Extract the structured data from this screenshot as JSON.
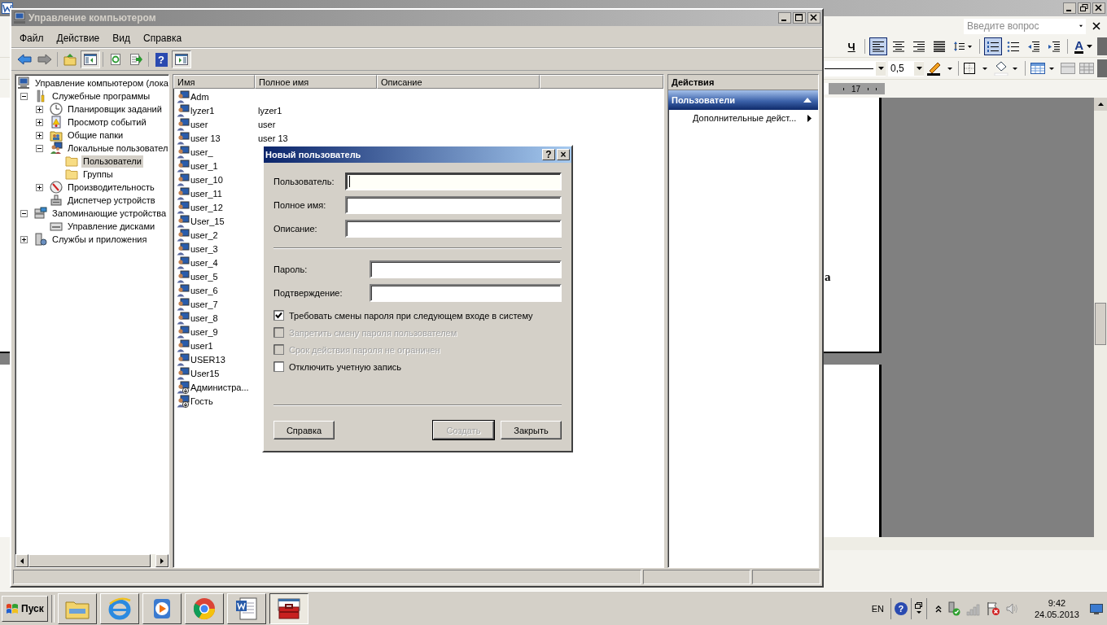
{
  "word_window": {
    "help_search": {
      "placeholder": "Введите вопрос"
    },
    "format_toolbar": [
      {
        "kind": "underline",
        "label": "Ч",
        "selected": false
      },
      {
        "kind": "align-left",
        "selected": true
      },
      {
        "kind": "align-center",
        "selected": false
      },
      {
        "kind": "align-right",
        "selected": false
      },
      {
        "kind": "justify",
        "selected": false
      },
      {
        "kind": "line-spacing",
        "selected": false
      },
      {
        "kind": "numbering",
        "selected": true
      },
      {
        "kind": "bullets",
        "selected": false
      },
      {
        "kind": "outdent",
        "selected": false
      },
      {
        "kind": "indent",
        "selected": false
      },
      {
        "kind": "font-color",
        "label": "A",
        "selected": false
      }
    ],
    "line_weight": "0,5",
    "ruler_mark": "17",
    "page_text": "а"
  },
  "window": {
    "title": "Управление компьютером"
  },
  "menu": [
    "Файл",
    "Действие",
    "Вид",
    "Справка"
  ],
  "toolbar": [
    {
      "kind": "back",
      "selected": false
    },
    {
      "kind": "forward",
      "selected": false
    },
    {
      "kind": "up",
      "selected": false
    },
    {
      "kind": "tree-toggle",
      "selected": true
    },
    {
      "kind": "refresh",
      "selected": false
    },
    {
      "kind": "export",
      "selected": false
    },
    {
      "kind": "help",
      "label": "?",
      "selected": false
    },
    {
      "kind": "actions-toggle",
      "selected": true
    }
  ],
  "tree": [
    {
      "label": "Управление компьютером (лока",
      "kind": "computer",
      "selected": false,
      "children": [
        {
          "label": "Служебные программы",
          "kind": "tools",
          "expanded": true,
          "selected": false,
          "children": [
            {
              "label": "Планировщик заданий",
              "kind": "clock",
              "expanded": false,
              "selected": false
            },
            {
              "label": "Просмотр событий",
              "kind": "log",
              "expanded": false,
              "selected": false
            },
            {
              "label": "Общие папки",
              "kind": "share",
              "expanded": false,
              "selected": false
            },
            {
              "label": "Локальные пользовател",
              "kind": "users",
              "expanded": true,
              "selected": false,
              "children": [
                {
                  "label": "Пользователи",
                  "kind": "folder",
                  "selected": true
                },
                {
                  "label": "Группы",
                  "kind": "folder",
                  "selected": false
                }
              ]
            },
            {
              "label": "Производительность",
              "kind": "gauge",
              "expanded": false,
              "selected": false
            },
            {
              "label": "Диспетчер устройств",
              "kind": "device",
              "selected": false
            }
          ]
        },
        {
          "label": "Запоминающие устройства",
          "kind": "storage",
          "expanded": true,
          "selected": false,
          "children": [
            {
              "label": "Управление дисками",
              "kind": "disk",
              "selected": false
            }
          ]
        },
        {
          "label": "Службы и приложения",
          "kind": "services",
          "expanded": false,
          "selected": false
        }
      ]
    }
  ],
  "list": {
    "columns": [
      "Имя",
      "Полное имя",
      "Описание"
    ],
    "rows": [
      {
        "name": "Adm",
        "disabled": false
      },
      {
        "name": "lyzer1",
        "full_name": "lyzer1",
        "disabled": false
      },
      {
        "name": "user",
        "full_name": "user",
        "disabled": false
      },
      {
        "name": "user 13",
        "full_name": "user 13",
        "disabled": false
      },
      {
        "name": "user_",
        "disabled": false
      },
      {
        "name": "user_1",
        "disabled": false
      },
      {
        "name": "user_10",
        "disabled": false
      },
      {
        "name": "user_11",
        "disabled": false
      },
      {
        "name": "user_12",
        "disabled": false
      },
      {
        "name": "User_15",
        "disabled": false
      },
      {
        "name": "user_2",
        "disabled": false
      },
      {
        "name": "user_3",
        "disabled": false
      },
      {
        "name": "user_4",
        "disabled": false
      },
      {
        "name": "user_5",
        "disabled": false
      },
      {
        "name": "user_6",
        "disabled": false
      },
      {
        "name": "user_7",
        "disabled": false
      },
      {
        "name": "user_8",
        "disabled": false
      },
      {
        "name": "user_9",
        "disabled": false
      },
      {
        "name": "user1",
        "disabled": false
      },
      {
        "name": "USER13",
        "disabled": false
      },
      {
        "name": "User15",
        "disabled": false
      },
      {
        "name": "Администра...",
        "disabled": true
      },
      {
        "name": "Гость",
        "disabled": true
      }
    ]
  },
  "actions": {
    "title": "Действия",
    "section": {
      "title": "Пользователи",
      "expanded": true
    },
    "items": [
      "Дополнительные дейст..."
    ]
  },
  "dialog": {
    "title": "Новый пользователь",
    "help": "?",
    "close": "×",
    "fields": [
      {
        "label": "Пользователь:",
        "focused": true
      },
      {
        "label": "Полное имя:",
        "focused": false
      },
      {
        "label": "Описание:",
        "focused": false
      }
    ],
    "password_fields": [
      {
        "label": "Пароль:"
      },
      {
        "label": "Подтверждение:"
      }
    ],
    "options": [
      {
        "label": "Требовать смены пароля при следующем входе в систему",
        "checked": true,
        "disabled": false
      },
      {
        "label": "Запретить смену пароля пользователем",
        "checked": false,
        "disabled": true
      },
      {
        "label": "Срок действия пароля не ограничен",
        "checked": false,
        "disabled": true
      },
      {
        "label": "Отключить учетную запись",
        "checked": false,
        "disabled": false
      }
    ],
    "buttons": [
      {
        "label": "Справка",
        "disabled": false,
        "default": false
      },
      {
        "label": "Создать",
        "disabled": true,
        "default": true
      },
      {
        "label": "Закрыть",
        "disabled": false,
        "default": false
      }
    ]
  },
  "taskbar": {
    "start": "Пуск",
    "apps": [
      {
        "kind": "explorer",
        "selected": false
      },
      {
        "kind": "browser",
        "selected": false
      },
      {
        "kind": "media",
        "selected": false
      },
      {
        "kind": "chrome",
        "selected": false
      },
      {
        "kind": "word",
        "selected": false
      },
      {
        "kind": "toolbox",
        "selected": true
      }
    ],
    "language": "EN",
    "tray_help": "?",
    "time": "9:42",
    "date": "24.05.2013"
  }
}
